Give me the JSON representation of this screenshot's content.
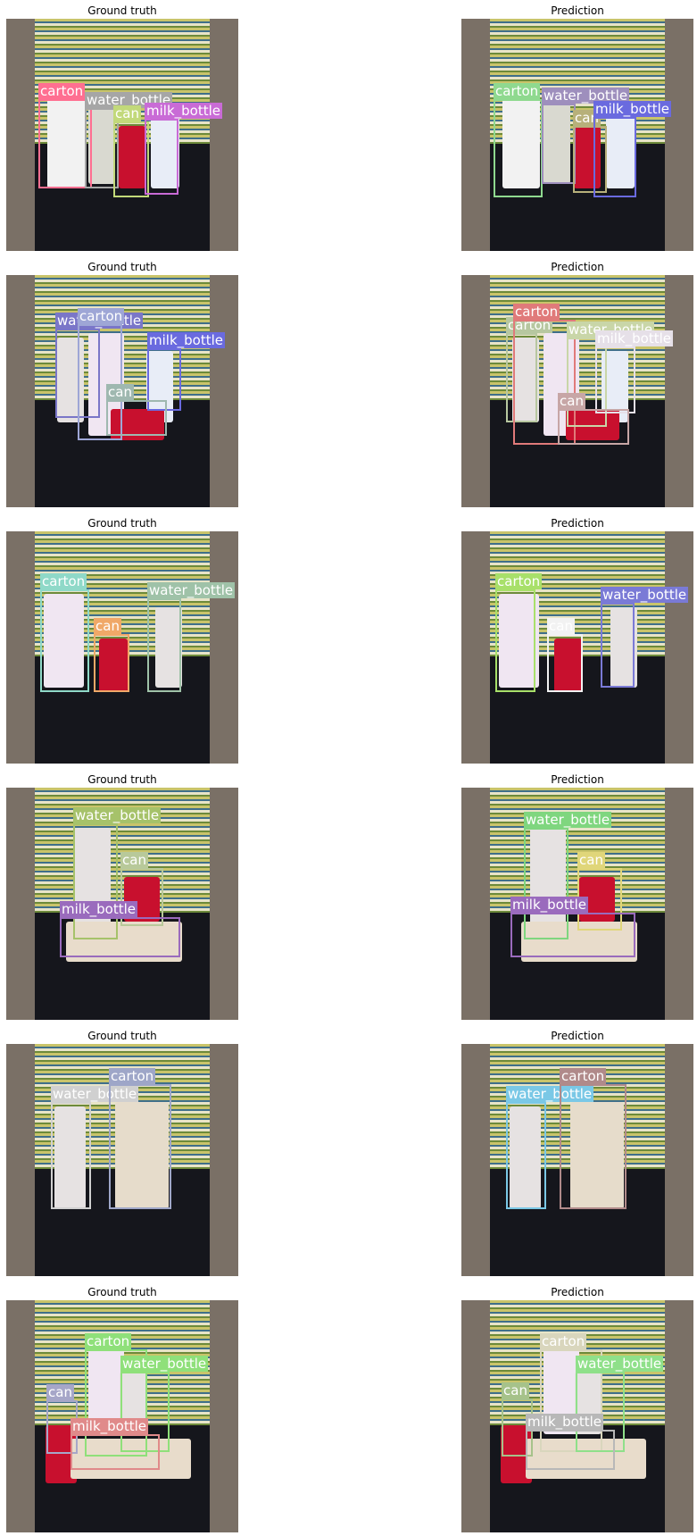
{
  "rows": [
    {
      "left_title": "Ground truth",
      "right_title": "Prediction",
      "objects": [
        {
          "kind": "carton",
          "color": "#f2f2f2"
        },
        {
          "kind": "bottle",
          "color": "#d9d9d0"
        },
        {
          "kind": "can",
          "color": "#c8102e"
        },
        {
          "kind": "bottle",
          "color": "#e8edf7"
        }
      ],
      "gt": [
        {
          "label": "carton",
          "color": "#ff6f91"
        },
        {
          "label": "water_bottle",
          "color": "#a6a6a6"
        },
        {
          "label": "can",
          "color": "#c2d97a"
        },
        {
          "label": "milk_bottle",
          "color": "#c96bd6"
        }
      ],
      "pred": [
        {
          "label": "carton",
          "color": "#8fd98f"
        },
        {
          "label": "water_bottle",
          "color": "#9e8fbd"
        },
        {
          "label": "can",
          "color": "#b7b07a"
        },
        {
          "label": "milk_bottle",
          "color": "#6a6adf"
        }
      ]
    },
    {
      "left_title": "Ground truth",
      "right_title": "Prediction",
      "objects": [
        {
          "kind": "bottle",
          "color": "#e6e2e2"
        },
        {
          "kind": "carton",
          "color": "#f0e6f2"
        },
        {
          "kind": "bottle",
          "color": "#e8edf7"
        },
        {
          "kind": "can",
          "color": "#c8102e"
        }
      ],
      "gt": [
        {
          "label": "water_bottle",
          "color": "#7a76c8"
        },
        {
          "label": "carton",
          "color": "#9ea6d6"
        },
        {
          "label": "milk_bottle",
          "color": "#6a6adf"
        },
        {
          "label": "can",
          "color": "#9fb8b0"
        }
      ],
      "pred": [
        {
          "label": "carton",
          "color": "#b7c7a0"
        },
        {
          "label": "carton",
          "color": "#e07a7a"
        },
        {
          "label": "water_bottle",
          "color": "#c9d6a8"
        },
        {
          "label": "milk_bottle",
          "color": "#e6e0e8"
        },
        {
          "label": "can",
          "color": "#c7a6a6"
        }
      ]
    },
    {
      "left_title": "Ground truth",
      "right_title": "Prediction",
      "objects": [
        {
          "kind": "carton",
          "color": "#f0e6f2"
        },
        {
          "kind": "can",
          "color": "#c8102e"
        },
        {
          "kind": "bottle",
          "color": "#e6e2e2"
        }
      ],
      "gt": [
        {
          "label": "carton",
          "color": "#8fd9c8"
        },
        {
          "label": "can",
          "color": "#f0a868"
        },
        {
          "label": "water_bottle",
          "color": "#9fc2a8"
        }
      ],
      "pred": [
        {
          "label": "carton",
          "color": "#a8e06a"
        },
        {
          "label": "can",
          "color": "#f2f2f2"
        },
        {
          "label": "water_bottle",
          "color": "#7a7ad6"
        }
      ]
    },
    {
      "left_title": "Ground truth",
      "right_title": "Prediction",
      "objects": [
        {
          "kind": "bottle",
          "color": "#e6e2e2"
        },
        {
          "kind": "can",
          "color": "#c8102e"
        },
        {
          "kind": "bottle",
          "color": "#e8dccb"
        }
      ],
      "gt": [
        {
          "label": "water_bottle",
          "color": "#a6c26a"
        },
        {
          "label": "can",
          "color": "#b8c99a"
        },
        {
          "label": "milk_bottle",
          "color": "#9a6bbd"
        }
      ],
      "pred": [
        {
          "label": "water_bottle",
          "color": "#7fd67f"
        },
        {
          "label": "can",
          "color": "#e0d67a"
        },
        {
          "label": "milk_bottle",
          "color": "#9a6bbd"
        }
      ]
    },
    {
      "left_title": "Ground truth",
      "right_title": "Prediction",
      "objects": [
        {
          "kind": "bottle",
          "color": "#e6e2e2"
        },
        {
          "kind": "carton",
          "color": "#e6dccb"
        }
      ],
      "gt": [
        {
          "label": "water_bottle",
          "color": "#d0d0d0"
        },
        {
          "label": "carton",
          "color": "#9ea6c8"
        }
      ],
      "pred": [
        {
          "label": "water_bottle",
          "color": "#7ac8e6"
        },
        {
          "label": "carton",
          "color": "#b08a8a"
        }
      ]
    },
    {
      "left_title": "Ground truth",
      "right_title": "Prediction",
      "objects": [
        {
          "kind": "carton",
          "color": "#f0e6f2"
        },
        {
          "kind": "bottle",
          "color": "#e6e2e2"
        },
        {
          "kind": "can",
          "color": "#c8102e"
        },
        {
          "kind": "bottle",
          "color": "#e8dccb"
        }
      ],
      "gt": [
        {
          "label": "carton",
          "color": "#8fe07a"
        },
        {
          "label": "water_bottle",
          "color": "#8fe07a"
        },
        {
          "label": "can",
          "color": "#a6a6c8"
        },
        {
          "label": "milk_bottle",
          "color": "#e08a8a"
        }
      ],
      "pred": [
        {
          "label": "carton",
          "color": "#d9d6bd"
        },
        {
          "label": "water_bottle",
          "color": "#8fe08a"
        },
        {
          "label": "can",
          "color": "#a6c28a"
        },
        {
          "label": "milk_bottle",
          "color": "#b8b8b8"
        }
      ]
    }
  ]
}
